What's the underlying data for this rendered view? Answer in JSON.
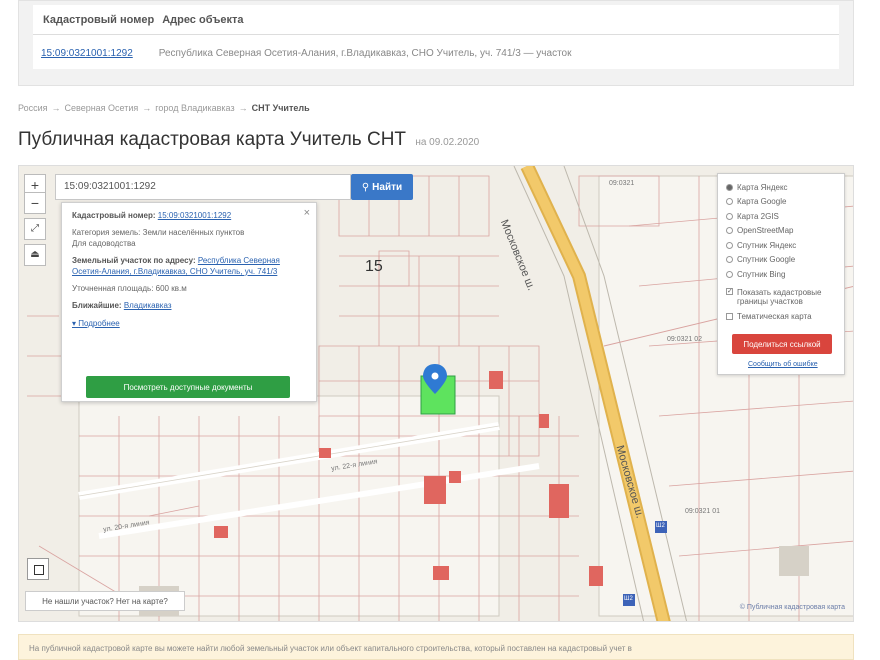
{
  "table": {
    "col_cadastral": "Кадастровый номер",
    "col_address": "Адрес объекта",
    "row_number": "15:09:0321001:1292",
    "row_address": "Республика Северная Осетия-Алания, г.Владикавказ, СНО Учитель, уч. 741/3 — участок"
  },
  "breadcrumb": {
    "items": [
      "Россия",
      "Северная Осетия",
      "город Владикавказ"
    ],
    "current": "СНТ Учитель",
    "sep": "→"
  },
  "title": {
    "text": "Публичная кадастровая карта Учитель СНТ",
    "date": "на 09.02.2020"
  },
  "map": {
    "search_value": "15:09:0321001:1292",
    "search_button": "Найти",
    "zoom_in": "+",
    "zoom_out": "−",
    "block_number": "15",
    "street_vertical": "Московское ш.",
    "street_vertical_2": "Московское ш.",
    "street_small": "ул. 22-я линия",
    "street_small_2": "ул. 20-я линия",
    "parcel_label_1": "09:0321",
    "parcel_label_2": "09:0321 02",
    "parcel_label_3": "09:0321 01",
    "road_sign_1": "Ш2",
    "road_sign_2": "Ш2",
    "question_text": "Не нашли участок? Нет на карте?",
    "attribution": "© Публичная кадастровая карта",
    "highlight_color": "#5ee35e",
    "marker_color": "#2f7ad3"
  },
  "popup": {
    "cad_label": "Кадастровый номер:",
    "cad_value": "15:09:0321001:1292",
    "category": "Категория земель: Земли населённых пунктов",
    "use_label": "Для садоводства",
    "address_label": "Земельный участок по адресу:",
    "address_value": "Республика Северная Осетия-Алания, г.Владикавказ, СНО Учитель, уч. 741/3",
    "area": "Уточненная площадь: 600 кв.м",
    "owner_label": "Ближайшие:",
    "owner_value": "Владикавказ",
    "details": "▾ Подробнее",
    "button": "Посмотреть доступные документы",
    "close": "×"
  },
  "layers": {
    "options": [
      "Карта Яндекс",
      "Карта Google",
      "Карта 2GIS",
      "OpenStreetMap",
      "Спутник Яндекс",
      "Спутник Google",
      "Спутник Bing"
    ],
    "selected": 0,
    "checkbox_1": "Показать кадастровые границы участков",
    "checkbox_2": "Тематическая карта",
    "button": "Поделиться ссылкой",
    "link": "Сообщить об ошибке"
  },
  "footer": {
    "text": "На публичной кадастровой карте вы можете найти любой земельный участок или объект капитального строительства, который поставлен на кадастровый учет в"
  }
}
